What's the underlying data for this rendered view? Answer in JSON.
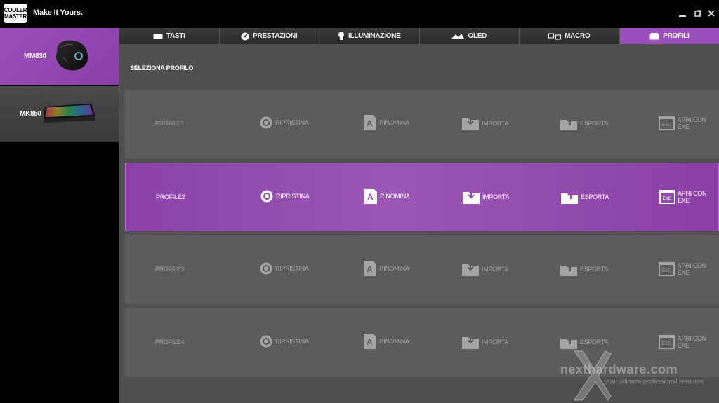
{
  "app": {
    "logo_line1": "COOLER",
    "logo_line2": "MASTER",
    "tagline": "Make It Yours."
  },
  "window_controls": [
    "minimize-icon",
    "restore-icon",
    "close-icon"
  ],
  "devices": [
    {
      "label": "MM830",
      "icon": "mouse-icon",
      "active": true
    },
    {
      "label": "MK850",
      "icon": "keyboard-icon",
      "active": false
    }
  ],
  "tabs": [
    {
      "label": "TASTI",
      "icon": "keys-icon",
      "active": false
    },
    {
      "label": "PRESTAZIONI",
      "icon": "performance-icon",
      "active": false
    },
    {
      "label": "ILLUMINAZIONE",
      "icon": "lighting-icon",
      "active": false
    },
    {
      "label": "OLED",
      "icon": "oled-icon",
      "active": false
    },
    {
      "label": "MACRO",
      "icon": "macro-icon",
      "active": false
    },
    {
      "label": "PROFILI",
      "icon": "profile-icon",
      "active": true
    }
  ],
  "section_title": "SELEZIONA PROFILO",
  "actions": {
    "reset": "RIPRISTINA",
    "rename": "RINOMINA",
    "import": "IMPORTA",
    "export": "ESPORTA",
    "open_exe": "APRI CON EXE"
  },
  "profiles": [
    {
      "name": "PROFILE1",
      "active": false
    },
    {
      "name": "PROFILE2",
      "active": true
    },
    {
      "name": "PROFILE3",
      "active": false
    },
    {
      "name": "PROFILE4",
      "active": false
    }
  ],
  "watermark": {
    "text": "nexthardware.com",
    "sub": "your ultimate professional resource"
  },
  "colors": {
    "accent": "#9b4fbc",
    "background": "#505052",
    "row": "#5c5c5e"
  }
}
